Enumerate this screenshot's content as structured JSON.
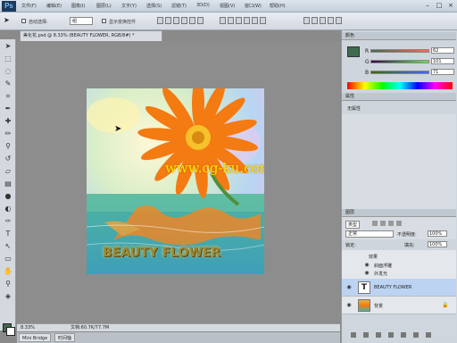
{
  "app": {
    "logo": "Ps"
  },
  "menubar": {
    "items": [
      "文件(F)",
      "编辑(E)",
      "图像(I)",
      "图层(L)",
      "文字(Y)",
      "选择(S)",
      "滤镜(T)",
      "3D(D)",
      "视图(V)",
      "窗口(W)",
      "帮助(H)"
    ]
  },
  "options": {
    "auto_select_label": "自动选择:",
    "auto_select_value": "组",
    "transform_label": "显示变换控件"
  },
  "document": {
    "tab_title": "美化花.psd @ 8.33% (BEAUTY FLOWER, RGB/8#) *",
    "zoom": "8.33%",
    "doc_info": "文档:60.7K/77.7M"
  },
  "image": {
    "watermark": "www.cg-ku.com",
    "text_layer": "BEAUTY FLOWER"
  },
  "bottom_tabs": {
    "mini_bridge": "Mini Bridge",
    "timeline": "时间轴"
  },
  "color_panel": {
    "tab": "颜色",
    "r_value": "62",
    "g_value": "101",
    "b_value": "71",
    "r_label": "R",
    "g_label": "G",
    "b_label": "B"
  },
  "properties_panel": {
    "tab": "属性",
    "content": "无属性"
  },
  "layers_panel": {
    "tab": "图层",
    "kind_label": "类型",
    "blend_mode": "正常",
    "opacity_label": "不透明度:",
    "opacity_value": "100%",
    "lock_label": "锁定:",
    "fill_label": "填充:",
    "fill_value": "100%",
    "effects_label": "效果",
    "effect_1": "斜面浮雕",
    "effect_2": "外发光",
    "text_layer_name": "BEAUTY FLOWER",
    "bg_layer_name": "背景"
  },
  "colors": {
    "fg": "#3f6a4e",
    "accent": "#f47a12"
  }
}
